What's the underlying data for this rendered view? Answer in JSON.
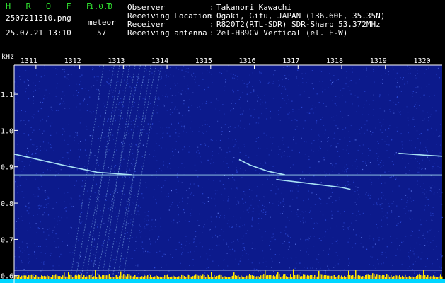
{
  "app": {
    "name": "H R O F F T",
    "version": "1.0.0"
  },
  "file": {
    "name": "2507211310.png",
    "datetime": "25.07.21 13:10"
  },
  "meteor": {
    "label": "meteor",
    "count": "57"
  },
  "info": {
    "rows": [
      {
        "key": "Observer",
        "sep": ":",
        "value": "Takanori Kawachi"
      },
      {
        "key": "Receiving Location",
        "sep": ":",
        "value": "Ogaki, Gifu, JAPAN (136.60E, 35.35N)"
      },
      {
        "key": "Receiver",
        "sep": ":",
        "value": "R820T2(RTL-SDR) SDR-Sharp 53.372MHz"
      },
      {
        "key": "Receiving antenna",
        "sep": ":",
        "value": "2el-HB9CV Vertical (el. E-W)"
      }
    ]
  },
  "chart_data": {
    "type": "heatmap",
    "ylabel": "kHz",
    "x_ticks": [
      "1311",
      "1312",
      "1313",
      "1314",
      "1315",
      "1316",
      "1317",
      "1318",
      "1319",
      "1320"
    ],
    "y_ticks": [
      "1.1",
      "1.0",
      "0.9",
      "0.8",
      "0.7",
      "0.6"
    ],
    "y_range": [
      0.58,
      1.18
    ],
    "x_range": [
      1310.5,
      1320.3
    ],
    "colors": {
      "background": "#0c1a8c",
      "noise": "#2f4fe0",
      "signal": "#b9f7ff",
      "axis": "#ffffff",
      "bars": "#ffe600",
      "base": "#00d6ff"
    }
  }
}
